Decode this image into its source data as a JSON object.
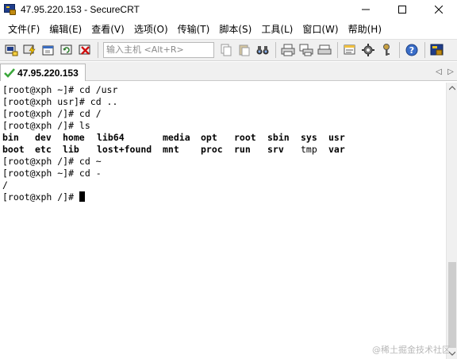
{
  "window": {
    "title": "47.95.220.153 - SecureCRT"
  },
  "menu": [
    "文件(F)",
    "编辑(E)",
    "查看(V)",
    "选项(O)",
    "传输(T)",
    "脚本(S)",
    "工具(L)",
    "窗口(W)",
    "帮助(H)"
  ],
  "toolbar": {
    "quick_connect_placeholder": "输入主机 <Alt+R>"
  },
  "tab": {
    "label": "47.95.220.153"
  },
  "terminal": {
    "lines": [
      "[root@xph ~]# cd /usr",
      "[root@xph usr]# cd ..",
      "[root@xph /]# cd /",
      "[root@xph /]# ls"
    ],
    "ls_output": [
      [
        "bin",
        "dev",
        "home",
        "lib64",
        "media",
        "opt",
        "root",
        "sbin",
        "sys",
        "usr"
      ],
      [
        "boot",
        "etc",
        "lib",
        "lost+found",
        "mnt",
        "proc",
        "run",
        "srv",
        "tmp",
        "var"
      ]
    ],
    "lines_after": [
      "[root@xph /]# cd ~",
      "[root@xph ~]# cd -",
      "/",
      "[root@xph /]# "
    ]
  },
  "watermark": "@稀土掘金技术社区",
  "colors": {
    "terminal_bg": "#ffffff",
    "terminal_fg": "#000000",
    "tab_check": "#3aa63a"
  }
}
